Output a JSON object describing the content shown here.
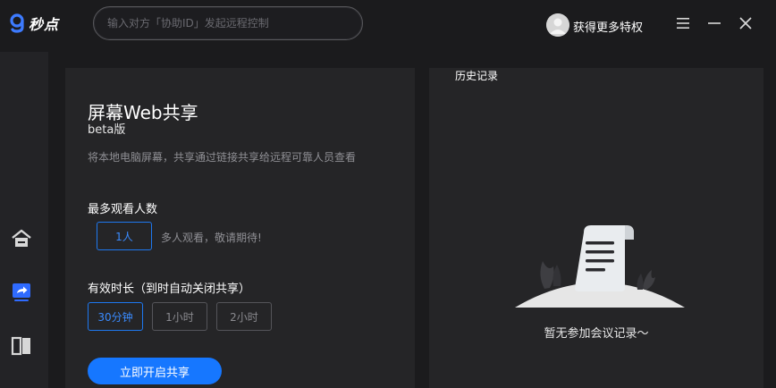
{
  "app": {
    "logo_text": "秒点"
  },
  "header": {
    "search_placeholder": "输入对方「协助ID」发起远程控制",
    "privilege_label": "获得更多特权"
  },
  "sidebar": {
    "items": [
      {
        "name": "home",
        "icon": "home-icon"
      },
      {
        "name": "web-share",
        "icon": "share-screen-icon",
        "active": true
      },
      {
        "name": "book",
        "icon": "book-icon"
      }
    ]
  },
  "share": {
    "title": "屏幕Web共享",
    "subtitle": "beta版",
    "description": "将本地电脑屏幕，共享通过链接共享给远程可靠人员查看",
    "viewers_label": "最多观看人数",
    "viewers_options": [
      "1人"
    ],
    "viewers_hint": "多人观看，敬请期待!",
    "duration_label": "有效时长（到时自动关闭共享）",
    "duration_options": [
      "30分钟",
      "1小时",
      "2小时"
    ],
    "start_button": "立即开启共享"
  },
  "history": {
    "title": "历史记录",
    "empty_text": "暂无参加会议记录～"
  },
  "colors": {
    "accent": "#1677ff",
    "background": "#1b1b1d",
    "panel": "#252527",
    "sidebar": "#232326"
  }
}
